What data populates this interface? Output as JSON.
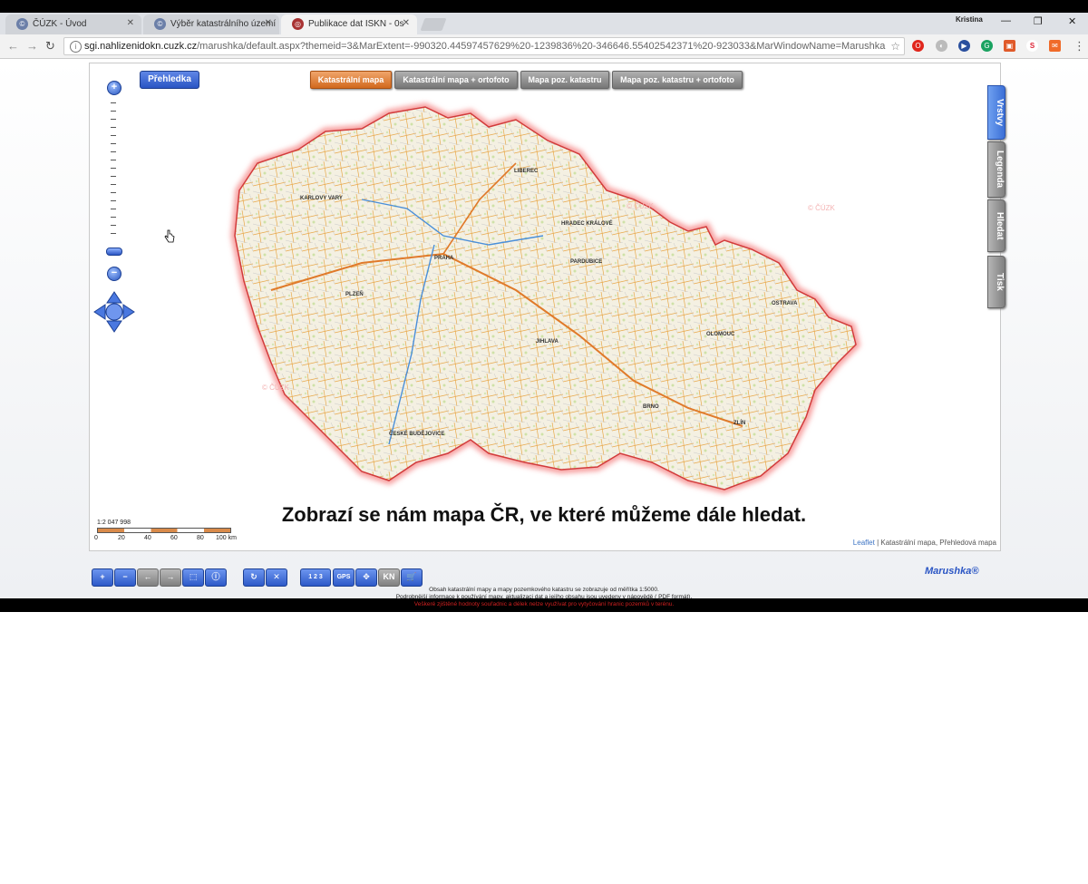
{
  "browser": {
    "tabs": [
      {
        "title": "ČÚZK - Úvod",
        "active": false
      },
      {
        "title": "Výběr katastrálního území",
        "active": false
      },
      {
        "title": "Publikace dat ISKN - 0s",
        "active": true
      }
    ],
    "profile_name": "Kristina",
    "url_host": "sgi.nahlizenidokn.cuzk.cz",
    "url_path": "/marushka/default.aspx?themeid=3&MarExtent=-990320.44597457629%20-1239836%20-346646.55402542371%20-923033&MarWindowName=Marushka"
  },
  "map": {
    "overview_button": "Přehledka",
    "layer_buttons": [
      {
        "label": "Katastrální mapa",
        "active": true
      },
      {
        "label": "Katastrální mapa + ortofoto",
        "active": false
      },
      {
        "label": "Mapa poz. katastru",
        "active": false
      },
      {
        "label": "Mapa poz. katastru + ortofoto",
        "active": false
      }
    ],
    "side_tabs": [
      {
        "label": "Vrstvy",
        "active": true
      },
      {
        "label": "Legenda",
        "active": false
      },
      {
        "label": "Hledat",
        "active": false
      },
      {
        "label": "Tisk",
        "active": false
      }
    ],
    "scale_text": "1:2 047 998",
    "scale_ticks": [
      "0",
      "20",
      "40",
      "60",
      "80",
      "100 km"
    ],
    "attribution_link": "Leaflet",
    "attribution_text": "| Katastrální mapa, Přehledová mapa",
    "watermark": "© ČÚZK",
    "cities": [
      "PRAHA",
      "PLZEŇ",
      "LIBEREC",
      "HRADEC KRÁLOVÉ",
      "PARDUBICE",
      "JIHLAVA",
      "BRNO",
      "OLOMOUC",
      "OSTRAVA",
      "ZLÍN",
      "KARLOVY VARY",
      "ČESKÉ BUDĚJOVICE"
    ]
  },
  "caption": "Zobrazí se nám mapa ČR, ve které můžeme dále hledat.",
  "toolbar": {
    "buttons": [
      "+",
      "−",
      "←",
      "→",
      "⬚",
      "ⓘ",
      "↻",
      "✕",
      "1 2 3",
      "GPS",
      "✥",
      "KN",
      "🛒"
    ],
    "brand": "Marushka®"
  },
  "footer": {
    "line1": "Obsah katastrální mapy a mapy pozemkového katastru se zobrazuje od měřítka 1:5000.",
    "line2_prefix": "Podrobnější informace k používání mapy, aktualizaci dat a jejího obsahu jsou uvedeny v",
    "line2_link1": "nápovědě",
    "line2_mid": "(",
    "line2_link2": "PDF",
    "line2_suffix": "formát).",
    "line3": "Veškeré zjištěné hodnoty souřadnic a délek nelze využívat pro vytyčování hranic pozemků v terénu."
  },
  "colors": {
    "accent_blue": "#2a55c4",
    "active_layer": "#d2691e",
    "warning_red": "#d02020"
  }
}
